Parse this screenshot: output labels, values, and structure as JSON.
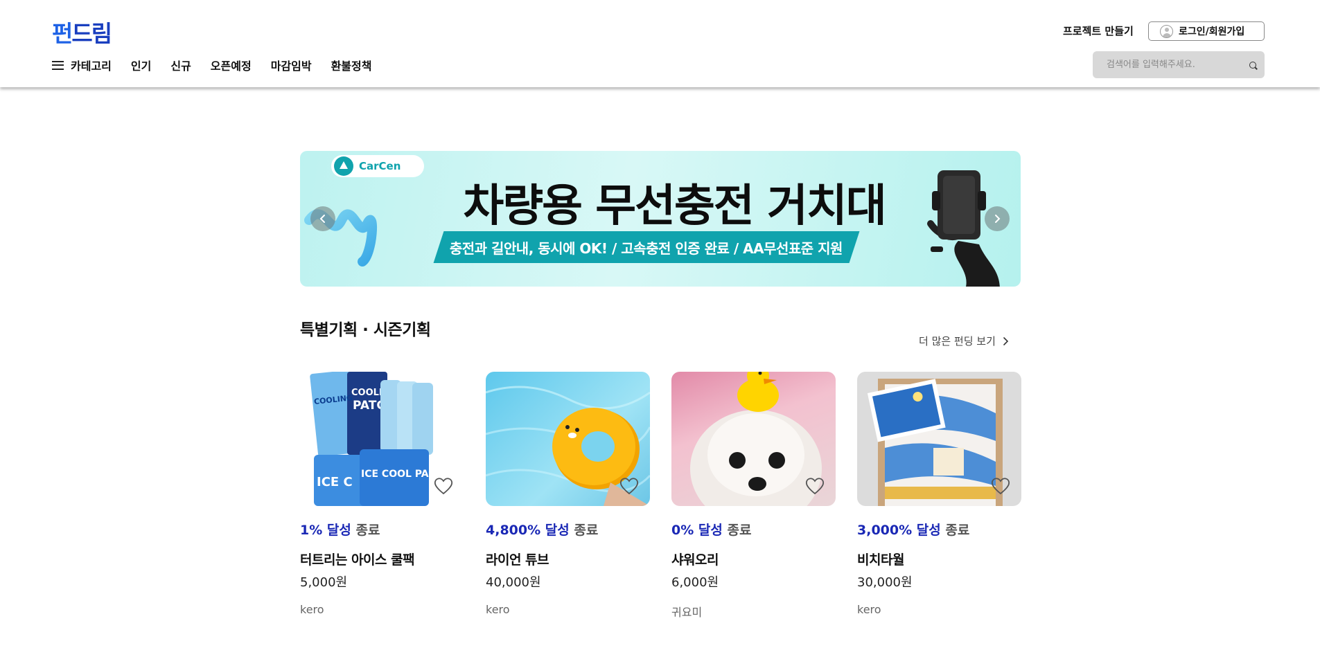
{
  "header": {
    "logo": {
      "part1": "펀",
      "part2": "드림"
    },
    "nav": [
      "카테고리",
      "인기",
      "신규",
      "오픈예정",
      "마감임박",
      "환불정책"
    ],
    "make_project": "프로젝트 만들기",
    "login": "로그인/회원가입",
    "search_placeholder": "검색어를 입력해주세요."
  },
  "banner": {
    "brand": "CarCen",
    "title": "차량용 무선충전 거치대",
    "subtitle": "충전과 길안내, 동시에 OK! / 고속충전 인증 완료 / AA무선표준 지원"
  },
  "section": {
    "title": "특별기획 · 시즌기획",
    "more": "더 많은 펀딩 보기"
  },
  "products": [
    {
      "rate": "1% 달성",
      "status": "종료",
      "name": "터트리는 아이스 쿨팩",
      "price": "5,000원",
      "maker": "kero"
    },
    {
      "rate": "4,800% 달성",
      "status": "종료",
      "name": "라이언 튜브",
      "price": "40,000원",
      "maker": "kero"
    },
    {
      "rate": "0% 달성",
      "status": "종료",
      "name": "샤워오리",
      "price": "6,000원",
      "maker": "귀요미"
    },
    {
      "rate": "3,000% 달성",
      "status": "종료",
      "name": "비치타월",
      "price": "30,000원",
      "maker": "kero"
    }
  ],
  "colors": {
    "brand": "#1e62e6",
    "accent": "#1a28b5",
    "banner_teal": "#10a3ad"
  }
}
